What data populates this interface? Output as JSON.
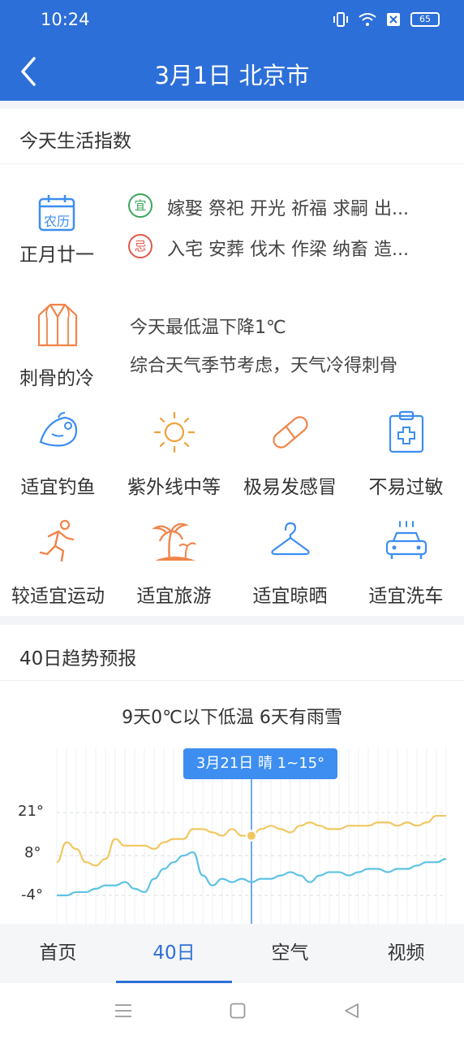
{
  "status_bar": {
    "time": "10:24",
    "battery": "65"
  },
  "header": {
    "title": "3月1日 北京市"
  },
  "life_index": {
    "title": "今天生活指数",
    "calendar": {
      "icon_text": "农历",
      "lunar_date": "正月廿一"
    },
    "yi": {
      "badge": "宜",
      "text": "嫁娶 祭祀 开光 祈福 求嗣 出..."
    },
    "ji": {
      "badge": "忌",
      "text": "入宅 安葬 伐木 作梁 纳畜 造..."
    },
    "cold": {
      "label": "刺骨的冷",
      "line1": "今天最低温下降1℃",
      "line2": "综合天气季节考虑，天气冷得刺骨"
    },
    "grid": [
      {
        "label": "适宜钓鱼",
        "icon": "fish-icon"
      },
      {
        "label": "紫外线中等",
        "icon": "sun-icon"
      },
      {
        "label": "极易发感冒",
        "icon": "pill-icon"
      },
      {
        "label": "不易过敏",
        "icon": "medical-kit-icon"
      },
      {
        "label": "较适宜运动",
        "icon": "running-icon"
      },
      {
        "label": "适宜旅游",
        "icon": "palm-tree-icon"
      },
      {
        "label": "适宜晾晒",
        "icon": "hanger-icon"
      },
      {
        "label": "适宜洗车",
        "icon": "car-wash-icon"
      }
    ]
  },
  "trend": {
    "title": "40日趋势预报",
    "summary": "9天0℃以下低温 6天有雨雪",
    "tooltip": "3月21日 晴 1~15°",
    "y_ticks": [
      "21°",
      "8°",
      "-4°"
    ]
  },
  "chart_data": {
    "type": "line",
    "ylim": [
      -7,
      34
    ],
    "y_ticks": [
      21,
      8,
      -4
    ],
    "highlight_index": 20,
    "series": [
      {
        "color": "#f2c761",
        "values": [
          6,
          12,
          10,
          6,
          5,
          7,
          13,
          11,
          11,
          11,
          10,
          12,
          13,
          13,
          16,
          16,
          15,
          14,
          16,
          14,
          14,
          16,
          17,
          16,
          15,
          17,
          18,
          17,
          16,
          16,
          17,
          17,
          17,
          18,
          18,
          17,
          18,
          17,
          18,
          20,
          20
        ]
      },
      {
        "color": "#5ec3e3",
        "values": [
          -4,
          -4,
          -3,
          -3,
          -2,
          -1,
          -1,
          0,
          -2,
          -3,
          1,
          4,
          6,
          8,
          9,
          2,
          -1,
          1,
          0,
          1,
          0,
          1,
          1,
          2,
          3,
          2,
          0,
          2,
          3,
          3,
          2,
          3,
          4,
          4,
          3,
          4,
          4,
          5,
          6,
          6,
          7
        ]
      }
    ]
  },
  "tabs": [
    {
      "label": "首页"
    },
    {
      "label": "40日"
    },
    {
      "label": "空气"
    },
    {
      "label": "视频"
    }
  ],
  "colors": {
    "primary": "#2d6fd8",
    "icon_orange": "#f0844a",
    "icon_blue": "#3d8ef0",
    "high_line": "#f2c761",
    "low_line": "#5ec3e3"
  }
}
